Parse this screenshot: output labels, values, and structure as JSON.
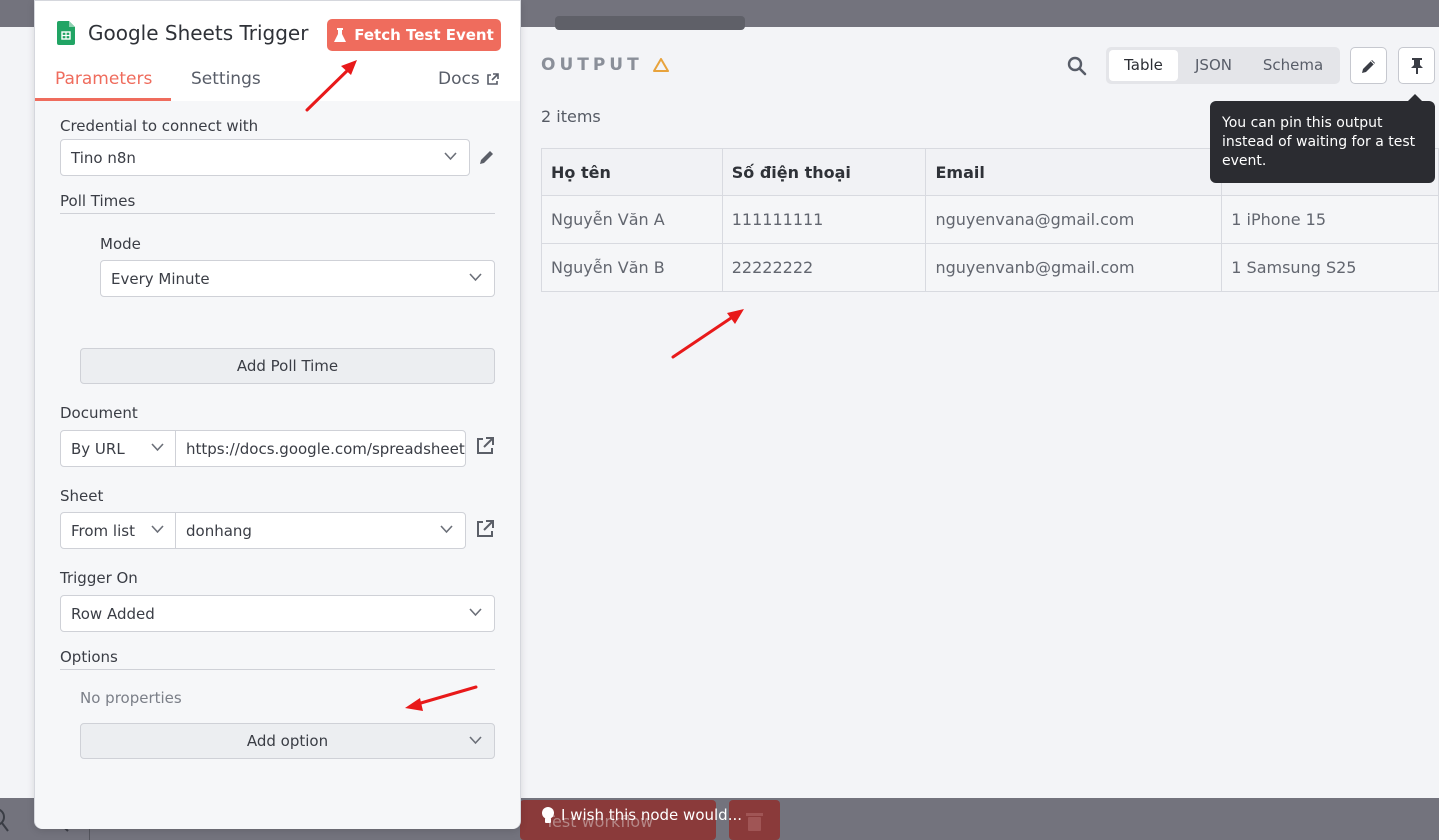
{
  "node": {
    "title": "Google Sheets Trigger",
    "fetch_button": "Fetch Test Event",
    "icon": "google-sheets-icon"
  },
  "tabs": {
    "parameters": "Parameters",
    "settings": "Settings",
    "docs": "Docs",
    "active": "Parameters"
  },
  "params": {
    "credential_label": "Credential to connect with",
    "credential_value": "Tino n8n",
    "poll_times_label": "Poll Times",
    "mode_label": "Mode",
    "mode_value": "Every Minute",
    "add_poll_time": "Add Poll Time",
    "document_label": "Document",
    "document_mode": "By URL",
    "document_url": "https://docs.google.com/spreadsheets/",
    "sheet_label": "Sheet",
    "sheet_mode": "From list",
    "sheet_value": "donhang",
    "trigger_label": "Trigger On",
    "trigger_value": "Row Added",
    "options_label": "Options",
    "no_properties": "No properties",
    "add_option": "Add option"
  },
  "output": {
    "title": "OUTPUT",
    "items_count": "2 items",
    "views": [
      "Table",
      "JSON",
      "Schema"
    ],
    "active_view": "Table",
    "tooltip": "You can pin this output instead of waiting for a test event.",
    "columns": [
      "Họ tên",
      "Số điện thoại",
      "Email",
      ""
    ],
    "rows": [
      [
        "Nguyễn Văn A",
        "111111111",
        "nguyenvana@gmail.com",
        "1 iPhone 15"
      ],
      [
        "Nguyễn Văn B",
        "22222222",
        "nguyenvanb@gmail.com",
        "1 Samsung S25"
      ]
    ]
  },
  "footer": {
    "wish_text": "I wish this node would...",
    "test_workflow": "Test workflow"
  },
  "colors": {
    "accent": "#ef6c5d",
    "annotation_arrow": "#e8191a",
    "warning": "#e8a33d"
  }
}
